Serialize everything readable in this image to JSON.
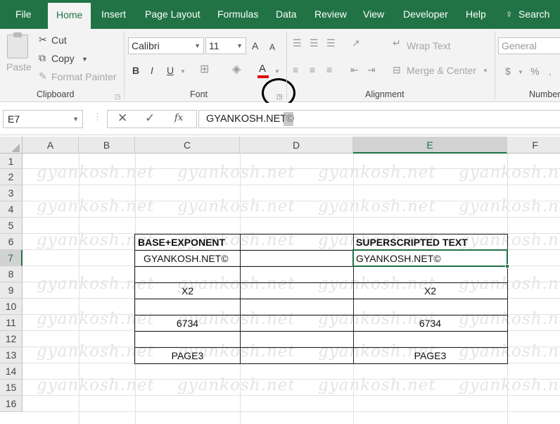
{
  "ribbon_tabs": [
    "File",
    "Home",
    "Insert",
    "Page Layout",
    "Formulas",
    "Data",
    "Review",
    "View",
    "Developer",
    "Help",
    "Search"
  ],
  "clipboard": {
    "paste": "Paste",
    "cut": "Cut",
    "copy": "Copy",
    "format_painter": "Format Painter",
    "group": "Clipboard"
  },
  "font": {
    "name": "Calibri",
    "size": "11",
    "group": "Font",
    "bold": "B",
    "italic": "I",
    "underline": "U",
    "grow": "A",
    "shrink": "A",
    "color": "A"
  },
  "alignment": {
    "wrap": "Wrap Text",
    "merge": "Merge & Center",
    "group": "Alignment"
  },
  "number": {
    "format": "General",
    "currency": "$",
    "percent": "%",
    "group": "Number"
  },
  "formula_bar": {
    "name_box": "E7",
    "fx": "fx",
    "content": "GYANKOSH.NET©"
  },
  "columns": [
    "A",
    "B",
    "C",
    "D",
    "E",
    "F"
  ],
  "rows": [
    "1",
    "2",
    "3",
    "4",
    "5",
    "6",
    "7",
    "8",
    "9",
    "10",
    "11",
    "12",
    "13",
    "14",
    "15",
    "16"
  ],
  "watermark": "gyankosh.net",
  "cells": {
    "C6": "BASE+EXPONENT",
    "E6": "SUPERSCRIPTED TEXT",
    "C7": "GYANKOSH.NET©",
    "E7": "GYANKOSH.NET©",
    "C9": "X2",
    "E9": "X2",
    "C11": "6734",
    "E11": "6734",
    "C13": "PAGE3",
    "E13": "PAGE3"
  },
  "colors": {
    "excel_green": "#217346",
    "highlight_circle": "#000000"
  }
}
